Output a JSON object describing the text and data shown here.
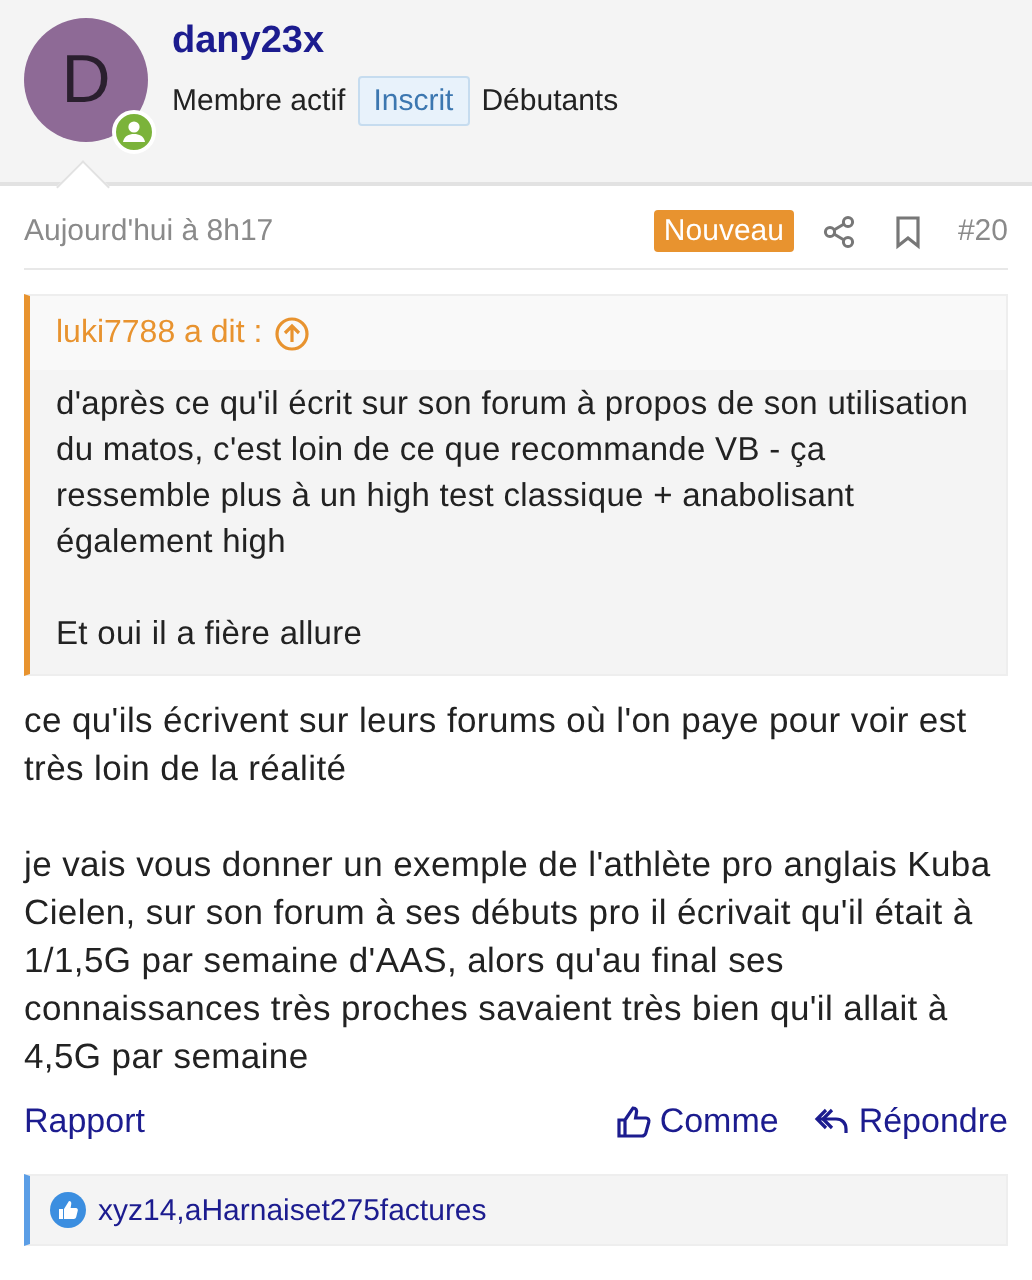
{
  "author": {
    "avatar_letter": "D",
    "online": true,
    "name": "dany23x",
    "title": "Membre actif",
    "badge": "Inscrit",
    "group": "Débutants"
  },
  "meta": {
    "date": "Aujourd'hui à 8h17",
    "new_badge": "Nouveau",
    "number": "#20"
  },
  "quote": {
    "header": "luki7788 a dit :",
    "paragraphs": [
      "d'après ce qu'il écrit sur son forum à propos de son utilisation du matos, c'est loin de ce que recommande VB - ça ressemble plus à un high test classique + anabolisant également high",
      "Et oui il a fière allure"
    ]
  },
  "body": [
    "ce qu'ils écrivent sur leurs forums où l'on paye pour voir est très loin de la réalité",
    "je vais vous donner un exemple de l'athlète pro anglais Kuba Cielen, sur son forum à ses débuts pro il écrivait qu'il était à 1/1,5G par semaine d'AAS, alors qu'au final ses connaissances très proches savaient très bien qu'il allait à 4,5G par semaine"
  ],
  "actions": {
    "report": "Rapport",
    "like": "Comme",
    "reply": "Répondre"
  },
  "likes": "xyz14,aHarnaiset275factures"
}
